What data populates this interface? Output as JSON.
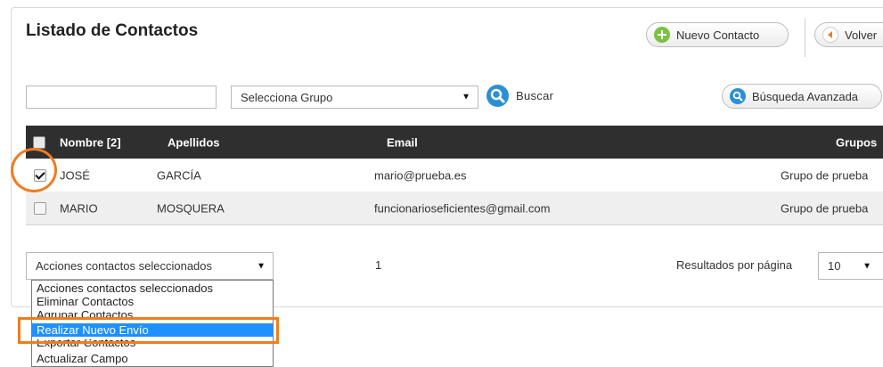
{
  "header": {
    "title": "Listado de Contactos",
    "new_contact_label": "Nuevo Contacto",
    "back_label": "Volver"
  },
  "search": {
    "input_value": "",
    "group_select_value": "Selecciona Grupo",
    "search_label": "Buscar",
    "advanced_label": "Búsqueda Avanzada"
  },
  "table": {
    "headers": {
      "name": "Nombre [2]",
      "surname": "Apellidos",
      "email": "Email",
      "groups": "Grupos"
    },
    "rows": [
      {
        "checked": true,
        "name": "JOSÉ",
        "surname": "GARCÍA",
        "email": "mario@prueba.es",
        "group": "Grupo de prueba"
      },
      {
        "checked": false,
        "name": "MARIO",
        "surname": "MOSQUERA",
        "email": "funcionarioseficientes@gmail.com",
        "group": "Grupo de prueba"
      }
    ]
  },
  "footer": {
    "actions_select_value": "Acciones contactos seleccionados",
    "page_number": "1",
    "results_per_page_label": "Resultados por página",
    "results_per_page_value": "10"
  },
  "actions_dropdown": {
    "options": [
      "Acciones contactos seleccionados",
      "Eliminar Contactos",
      "Agrupar Contactos",
      "Realizar Nuevo Envío",
      "Exportar Contactos",
      "Actualizar Campo"
    ],
    "selected_index": 3
  },
  "colors": {
    "highlight": "#f07c1f",
    "header_bg": "#2f2f2f",
    "selected_option": "#1e90ff",
    "accent_blue": "#2b8fd6",
    "accent_green": "#7dc142"
  }
}
